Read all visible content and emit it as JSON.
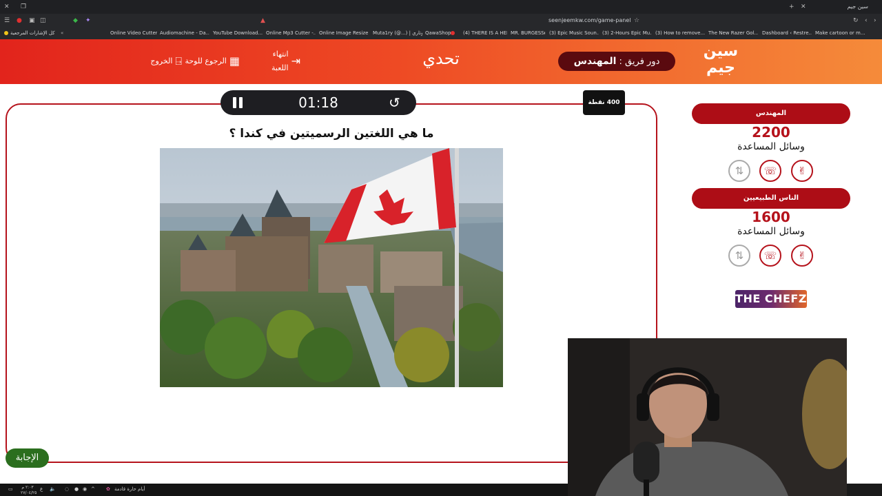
{
  "browser": {
    "tab_title": "سين جيم",
    "url": "seenjeemkw.com/game-panel",
    "bookmarks_all_label": "كل الإشارات المرجعية",
    "bookmarks": [
      "Online Video Cutter",
      "Audiomachine - Da...",
      "YouTube Download...",
      "Online Mp3 Cutter -...",
      "Online Image Resize...",
      "Muta1ry (@...) | موتاري",
      "QawaShop",
      "(4) THERE IS A HER...",
      "MR. BURGESS",
      "(3) Epic Music Soun...",
      "(3) 2-Hours Epic Mu...",
      "(3) How to remove...",
      "The New Razer Gol...",
      "Dashboard ‹ Restre...",
      "Make cartoon or m..."
    ]
  },
  "header": {
    "logo_line1": "سين",
    "logo_line2": "جيم",
    "team_turn_prefix": "دور فريق :",
    "team_turn_name": "المهندس",
    "title": "تحدي",
    "btn_end_game": "انتهاء اللعبة",
    "btn_back_board": "الرجوع للوحة",
    "btn_exit": "الخروج"
  },
  "game": {
    "timer": "01:18",
    "points_badge": "400 نقطة",
    "question": "ما هي اللغتين الرسميتين في كندا ؟",
    "answer_button": "الإجابة"
  },
  "teams": [
    {
      "name": "المهندس",
      "score": "2200",
      "help_label": "وسائل المساعدة"
    },
    {
      "name": "الناس الطبيعيين",
      "score": "1600",
      "help_label": "وسائل المساعدة"
    }
  ],
  "sponsor": "THE CHEFZ",
  "taskbar": {
    "weather_text": "أيام حارة قادمة",
    "time": "٢:٠٣ م",
    "date": "٢٧/٠٤/٢٥"
  },
  "colors": {
    "brand_red": "#b5121b",
    "header_gradient_start": "#e2241c",
    "header_gradient_end": "#f58b3a",
    "answer_green": "#2b6e1e"
  },
  "icons": {
    "pause": "pause-icon",
    "reset": "reset-icon",
    "lifeline_two_answers": "peace-hand-icon",
    "lifeline_call": "phone-icon",
    "lifeline_swap": "swap-icon"
  }
}
